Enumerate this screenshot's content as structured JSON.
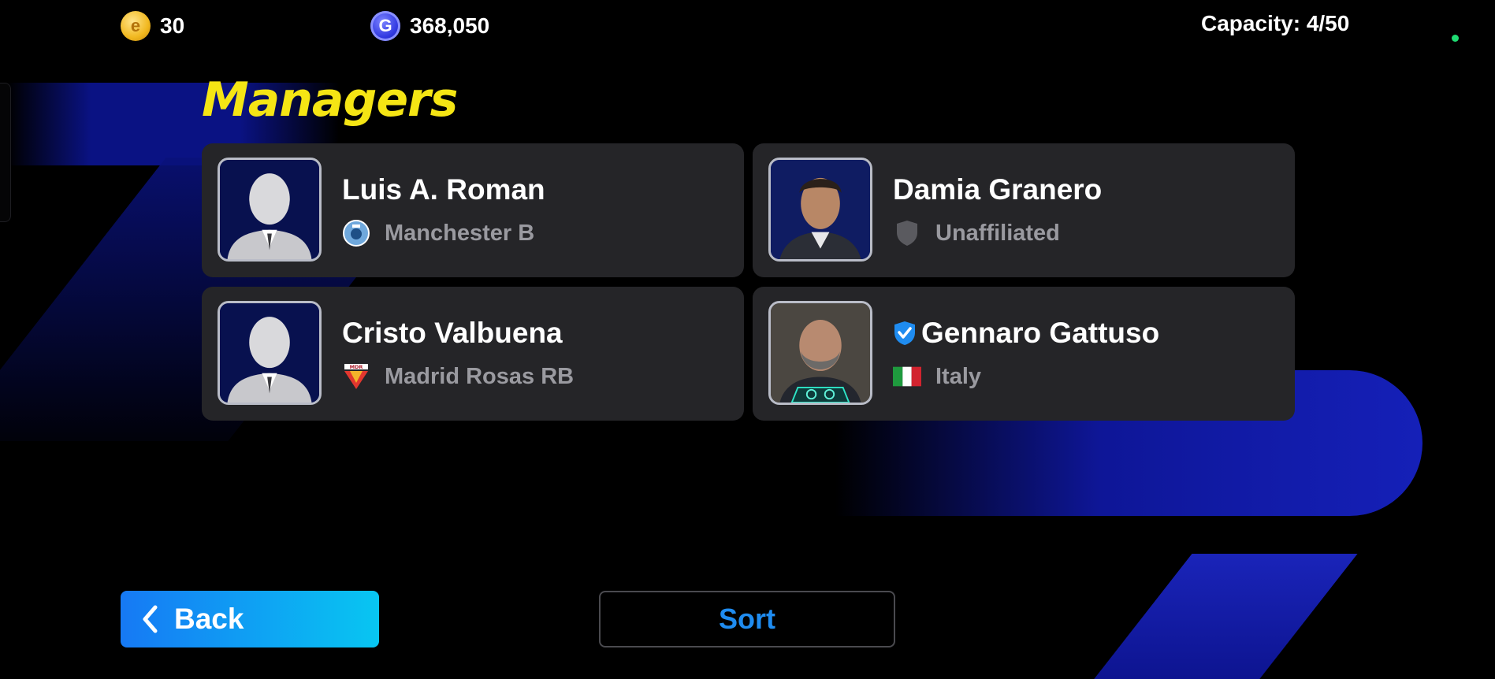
{
  "currencies": {
    "coins": {
      "icon": "e-coin-icon",
      "value": "30"
    },
    "gp": {
      "icon": "gp-coin-icon",
      "value": "368,050"
    }
  },
  "capacity": "Capacity: 4/50",
  "title": "Managers",
  "managers": [
    {
      "name": "Luis A. Roman",
      "club": "Manchester B",
      "club_icon": "manchester-b-crest-icon",
      "portrait": "generic-silhouette",
      "verified": false
    },
    {
      "name": "Damia Granero",
      "club": "Unaffiliated",
      "club_icon": "shield-icon",
      "portrait": "manager-photo",
      "verified": false
    },
    {
      "name": "Cristo Valbuena",
      "club": "Madrid Rosas RB",
      "club_icon": "mdr-crest-icon",
      "club_icon_text": "MDR",
      "portrait": "generic-silhouette",
      "verified": false
    },
    {
      "name": "Gennaro Gattuso",
      "club": "Italy",
      "club_icon": "italy-flag-icon",
      "portrait": "manager-photo",
      "verified": true
    }
  ],
  "buttons": {
    "back": "Back",
    "sort": "Sort"
  },
  "colors": {
    "title": "#f5e514",
    "back_start": "#1679f4",
    "back_end": "#08c6f2",
    "sort_text": "#1f8cf0",
    "card": "#252528"
  }
}
